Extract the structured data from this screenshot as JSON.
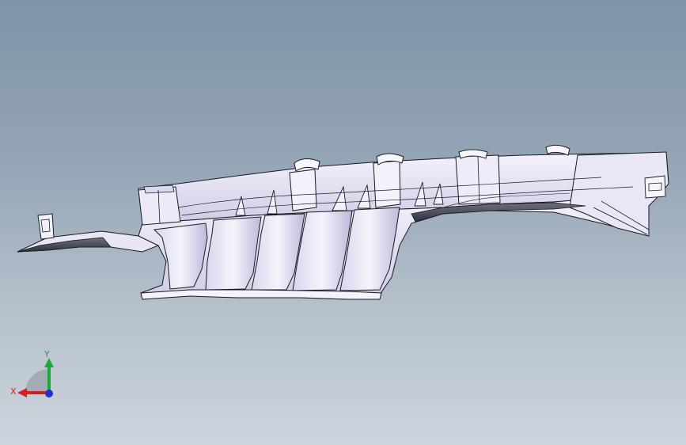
{
  "viewport": {
    "background_top": "#7f94a8",
    "background_bottom": "#cdd4dc",
    "model": {
      "part_face_color": "#e6e4f3",
      "part_shade_color": "#b7b3d6",
      "part_dark_color": "#4a4d5c",
      "edge_color": "#1a1a22"
    }
  },
  "triad": {
    "x_label": "X",
    "y_label": "Y",
    "x_color": "#d42020",
    "y_color": "#1fa83a",
    "z_color": "#2030d0"
  }
}
